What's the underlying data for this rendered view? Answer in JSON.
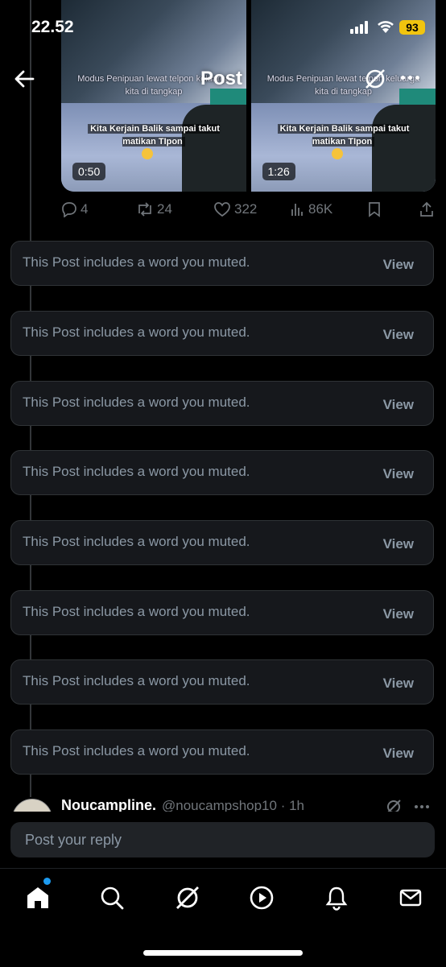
{
  "status_bar": {
    "time": "22.52",
    "battery": "93"
  },
  "header": {
    "title": "Post"
  },
  "videos": [
    {
      "caption_top": "Modus Penipuan lewat telpon keluarga kita di tangkap",
      "caption_bottom": "Kita Kerjain Balik sampai takut matikan TIpon",
      "duration": "0:50"
    },
    {
      "caption_top": "Modus Penipuan lewat telpon keluarga kita di tangkap",
      "caption_bottom": "Kita Kerjain Balik sampai takut matikan TIpon",
      "duration": "1:26"
    }
  ],
  "actions": {
    "replies": "4",
    "reposts": "24",
    "likes": "322",
    "views": "86K"
  },
  "muted_posts": [
    {
      "text": "This Post includes a word you muted.",
      "action": "View"
    },
    {
      "text": "This Post includes a word you muted.",
      "action": "View"
    },
    {
      "text": "This Post includes a word you muted.",
      "action": "View"
    },
    {
      "text": "This Post includes a word you muted.",
      "action": "View"
    },
    {
      "text": "This Post includes a word you muted.",
      "action": "View"
    },
    {
      "text": "This Post includes a word you muted.",
      "action": "View"
    },
    {
      "text": "This Post includes a word you muted.",
      "action": "View"
    },
    {
      "text": "This Post includes a word you muted.",
      "action": "View"
    }
  ],
  "reply_preview": {
    "name": "Noucampline.",
    "handle_time": "@noucampshop10 · 1h"
  },
  "reply_box": {
    "placeholder": "Post your reply"
  },
  "nav": [
    "home-icon",
    "search-icon",
    "grok-icon",
    "video-icon",
    "notifications-icon",
    "messages-icon"
  ],
  "colors": {
    "background": "#000000",
    "card": "#16181c",
    "muted_text": "#8b98a5",
    "accent": "#1d9bf0",
    "battery": "#f1c40f"
  }
}
